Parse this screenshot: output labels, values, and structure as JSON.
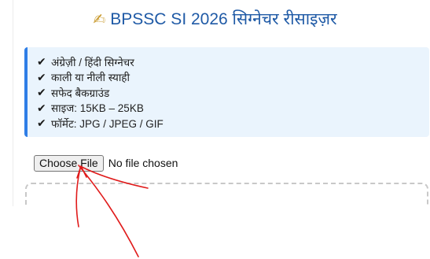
{
  "header": {
    "icon": "writing-hand-icon",
    "title": "BPSSC SI 2026 सिग्नेचर रीसाइज़र"
  },
  "requirements": {
    "items": [
      "अंग्रेज़ी / हिंदी सिग्नेचर",
      "काली या नीली स्याही",
      "सफेद बैकग्राउंड",
      "साइज: 15KB – 25KB",
      "फॉर्मेट: JPG / JPEG / GIF"
    ]
  },
  "file_input": {
    "button_label": "Choose File",
    "status": "No file chosen"
  },
  "colors": {
    "title": "#1f5aa6",
    "info_background": "#eaf4fd",
    "info_accent": "#2f7ee6",
    "annotation": "#e01b1b"
  }
}
